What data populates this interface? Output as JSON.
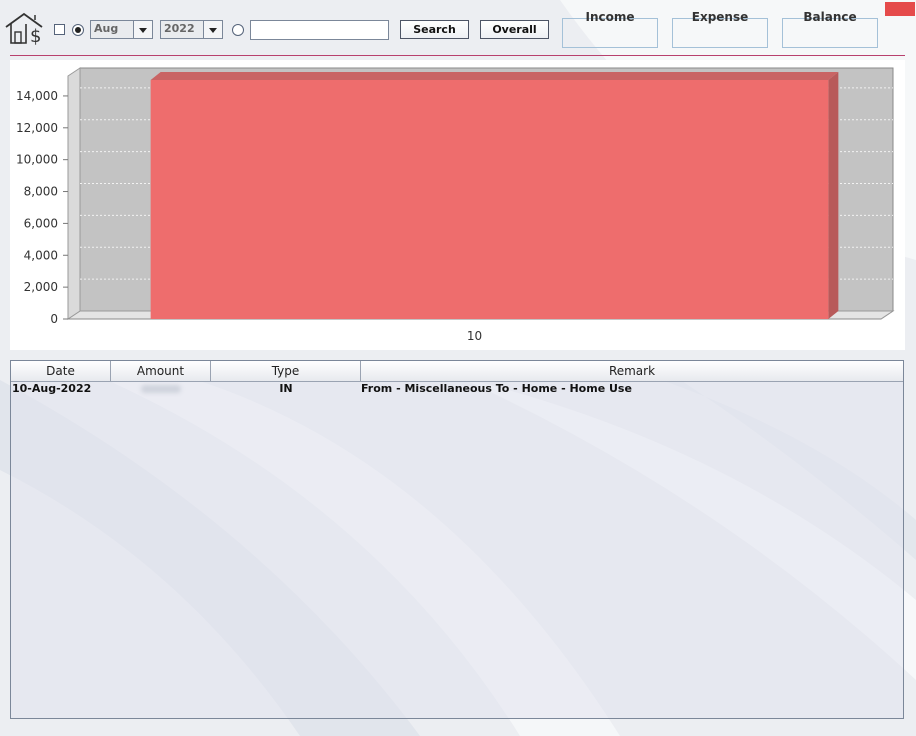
{
  "toolbar": {
    "month_value": "Aug",
    "year_value": "2022",
    "search_value": "",
    "search_label": "Search",
    "overall_label": "Overall"
  },
  "summary": {
    "income_label": "Income",
    "expense_label": "Expense",
    "balance_label": "Balance"
  },
  "chart_data": {
    "type": "bar",
    "categories": [
      "10"
    ],
    "values": [
      15000
    ],
    "ylim": [
      0,
      15000
    ],
    "yticks": [
      0,
      2000,
      4000,
      6000,
      8000,
      10000,
      12000,
      14000
    ],
    "ytick_labels": [
      "0",
      "2,000",
      "4,000",
      "6,000",
      "8,000",
      "10,000",
      "12,000",
      "14,000"
    ],
    "grid": true,
    "bar_color": "#ee6d6d",
    "title": "",
    "xlabel": "",
    "ylabel": ""
  },
  "table": {
    "columns": [
      "Date",
      "Amount",
      "Type",
      "Remark"
    ],
    "rows": [
      {
        "date": "10-Aug-2022",
        "type": "IN",
        "remark": "From - Miscellaneous To - Home - Home Use"
      }
    ]
  }
}
